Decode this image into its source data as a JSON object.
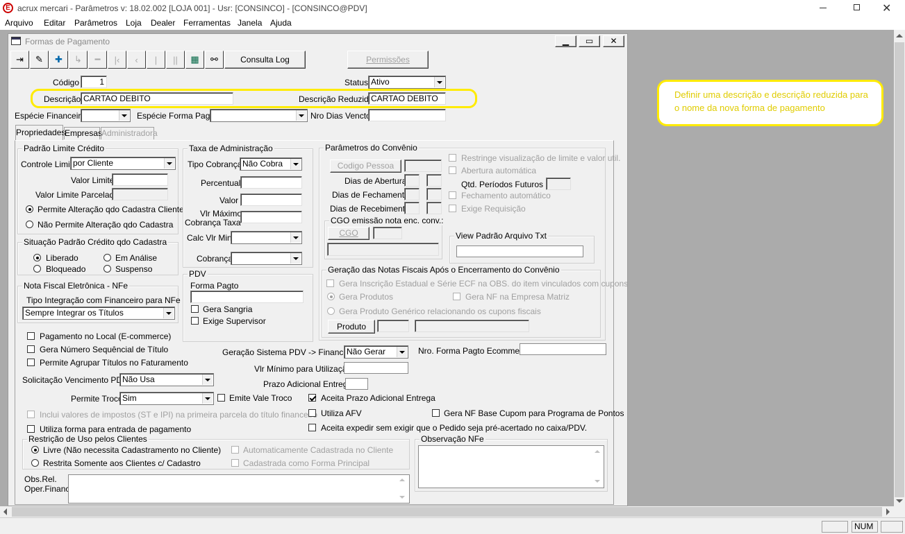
{
  "app": {
    "title": "acrux mercari - Parâmetros  v: 18.02.002   [LOJA 001] - Usr: [CONSINCO] - [CONSINCO@PDV]",
    "logo": "E"
  },
  "menu": [
    "Arquivo",
    "Editar",
    "Parâmetros",
    "Loja",
    "Dealer",
    "Ferramentas",
    "Janela",
    "Ajuda"
  ],
  "window": {
    "title": "Formas de Pagamento"
  },
  "toolbar": {
    "consulta_log": "Consulta Log",
    "permissoes": "Permissões"
  },
  "form": {
    "codigo_label": "Código",
    "codigo": "1",
    "status_label": "Status",
    "status": "Ativo",
    "descricao_label": "Descrição",
    "descricao": "CARTAO DEBITO",
    "desc_reduzida_label": "Descrição Reduzida",
    "desc_reduzida": "CARTAO DEBITO",
    "especie_fin_label": "Espécie Financeira",
    "especie_forma_label": "Espécie Forma Pagto",
    "nro_dias_label": "Nro Dias Vencto"
  },
  "tabs": [
    "Propriedades",
    "Empresas",
    "Administradora"
  ],
  "limite": {
    "title": "Padrão Limite Crédito",
    "controle_label": "Controle Limite",
    "controle": "por Cliente",
    "valor_label": "Valor Limite",
    "parcelado_label": "Valor Limite Parcelado",
    "opt1": "Permite Alteração qdo Cadastra Cliente",
    "opt2": "Não Permite Alteração qdo Cadastra"
  },
  "situacao": {
    "title": "Situação Padrão Crédito qdo Cadastra",
    "liberado": "Liberado",
    "em_analise": "Em Análise",
    "bloqueado": "Bloqueado",
    "suspenso": "Suspenso"
  },
  "nfe": {
    "title": "Nota Fiscal Eletrônica - NFe",
    "tipo_label": "Tipo Integração com Financeiro para NFe",
    "tipo": "Sempre Integrar os Títulos"
  },
  "taxa": {
    "title": "Taxa de Administração",
    "tipo_label": "Tipo Cobrança",
    "tipo": "Não Cobra",
    "percentual": "Percentual",
    "valor": "Valor",
    "vlr_max1": "Vlr Máximo",
    "vlr_max2": "Cobrança Taxa",
    "calc": "Calc Vlr Min",
    "cobranca": "Cobrança"
  },
  "pdv": {
    "title": "PDV",
    "forma_label": "Forma Pagto",
    "sangria": "Gera Sangria",
    "supervisor": "Exige Supervisor"
  },
  "convenio": {
    "title": "Parâmetros do Convênio",
    "codigo_pessoa": "Codigo Pessoa",
    "abertura": "Dias de Abertura",
    "fechamento": "Dias de Fechamento",
    "recebimento": "Dias de Recebimento",
    "restringe": "Restringe visualização de limite e valor util.",
    "abertura_auto": "Abertura automática",
    "qtd_periodos": "Qtd. Períodos Futuros",
    "fech_auto": "Fechamento automático",
    "exige_req": "Exige Requisição",
    "cgo_title": "CGO emissão nota enc. conv.:",
    "cgo_btn": "CGO",
    "view_title": "View Padrão Arquivo Txt"
  },
  "geracao": {
    "title": "Geração das Notas Fiscais Após o Encerramento do Convênio",
    "insc": "Gera Inscrição Estadual e Série ECF na OBS. do item vinculados com cupons",
    "produtos": "Gera Produtos",
    "nf_matriz": "Gera NF na Empresa Matriz",
    "generico": "Gera Produto Genérico relacionando os cupons fiscais",
    "produto_btn": "Produto"
  },
  "checks": {
    "local": "Pagamento no Local (E-commerce)",
    "sequencial": "Gera Número Sequêncial de Título",
    "agrupar": "Permite Agrupar Títulos no Faturamento"
  },
  "solic_label": "Solicitação Vencimento PDV",
  "solic": "Não Usa",
  "troco_label": "Permite Troco",
  "troco": "Sim",
  "vale_troco": "Emite Vale Troco",
  "impostos": "Inclui valores de impostos (ST e IPI) na primeira parcela do título financeiro",
  "entrada": "Utiliza forma para entrada de pagamento",
  "ger_pdv_label": "Geração Sistema PDV -> Financeiro",
  "ger_pdv": "Não Gerar",
  "nro_ecom_label": "Nro. Forma Pagto Ecommerce",
  "vlr_min_label": "Vlr Mínimo para Utilização",
  "prazo_label": "Prazo Adicional Entrega",
  "aceita_prazo": "Aceita Prazo Adicional Entrega",
  "afv": "Utiliza AFV",
  "nf_base": "Gera NF Base Cupom para Programa de Pontos",
  "expedir": "Aceita expedir sem exigir que o Pedido seja pré-acertado no caixa/PDV.",
  "restricao": {
    "title": "Restrição de Uso pelos Clientes",
    "livre": "Livre (Não necessita Cadastramento no Cliente)",
    "restrita": "Restrita Somente aos Clientes c/ Cadastro",
    "auto": "Automaticamente Cadastrada no Cliente",
    "principal": "Cadastrada como Forma Principal"
  },
  "obs_nfe": "Observação NFe",
  "obs_rel1": "Obs.Rel.",
  "obs_rel2": "Oper.Financ.",
  "callout": "Definir uma descrição e descrição reduzida para o nome da nova forma de pagamento",
  "status_bar": {
    "num": "NUM"
  },
  "colors": {
    "highlight": "#ffeb00",
    "callout_text": "#ffeb00",
    "callout_bg": "#ffffff",
    "window_title": "#8a8a8a",
    "mdi_bg": "#ababab"
  }
}
